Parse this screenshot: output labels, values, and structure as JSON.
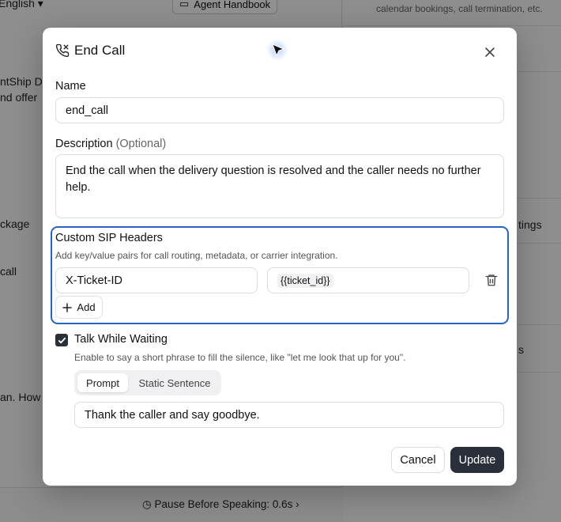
{
  "background": {
    "language": "English",
    "handbook": "Agent Handbook",
    "right_hint": "calendar bookings, call termination, etc.",
    "left_snippet_1": "ntShip D",
    "left_snippet_2": "nd offer",
    "left_snippet_3": "ckage",
    "left_snippet_4": "call",
    "left_snippet_5": "an. How",
    "right_snippet_1": "tings",
    "right_snippet_2": "s",
    "pause_label": "Pause Before Speaking: 0.6s"
  },
  "modal": {
    "title": "End Call",
    "name_label": "Name",
    "name_value": "end_call",
    "description_label": "Description",
    "description_optional": "(Optional)",
    "description_value": "End the call when the delivery question is resolved and the caller needs no further help.",
    "sip": {
      "title": "Custom SIP Headers",
      "help": "Add key/value pairs for call routing, metadata, or carrier integration.",
      "header_key": "X-Ticket-ID",
      "header_value": "{{ticket_id}}",
      "add_label": "Add"
    },
    "talk": {
      "label": "Talk While Waiting",
      "help": "Enable to say a short phrase to fill the silence, like \"let me look that up for you\".",
      "checked": true,
      "modes": [
        "Prompt",
        "Static Sentence"
      ],
      "active_mode": "Prompt",
      "phrase": "Thank the caller and say goodbye."
    },
    "cancel_label": "Cancel",
    "update_label": "Update"
  },
  "colors": {
    "accent_border": "#2563c9",
    "primary_button": "#2b2f3a"
  },
  "icons": [
    "phone-icon",
    "close-icon",
    "trash-icon",
    "plus-icon",
    "check-icon",
    "cursor-icon",
    "clock-icon"
  ]
}
